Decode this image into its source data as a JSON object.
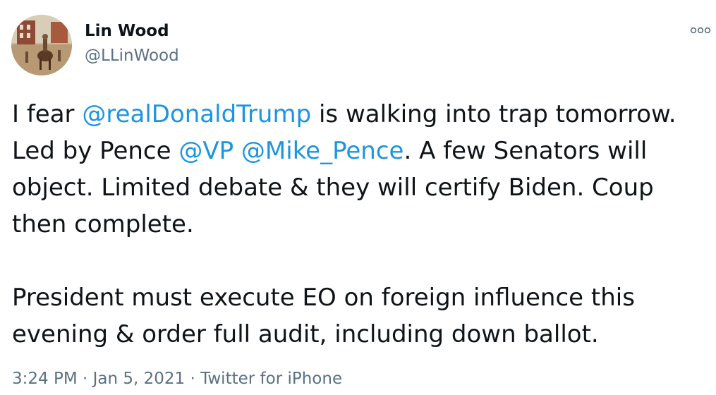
{
  "author": {
    "display_name": "Lin Wood",
    "handle": "@LLinWood"
  },
  "more_icon": "more-options-icon",
  "tweet": {
    "lines": [
      [
        {
          "text": "I fear ",
          "mention": false
        },
        {
          "text": "@realDonaldTrump",
          "mention": true
        },
        {
          "text": " is walking into trap tomorrow.",
          "mention": false
        }
      ],
      [
        {
          "text": "Led by Pence ",
          "mention": false
        },
        {
          "text": "@VP",
          "mention": true
        },
        {
          "text": " ",
          "mention": false
        },
        {
          "text": "@Mike_Pence",
          "mention": true
        },
        {
          "text": ". A few Senators will",
          "mention": false
        }
      ],
      [
        {
          "text": "object. Limited debate & they will certify Biden. Coup",
          "mention": false
        }
      ],
      [
        {
          "text": "then complete.",
          "mention": false
        }
      ],
      null,
      [
        {
          "text": "President must execute EO on foreign influence this",
          "mention": false
        }
      ],
      [
        {
          "text": "evening & order full audit, including down ballot.",
          "mention": false
        }
      ]
    ]
  },
  "meta": {
    "time": "3:24 PM",
    "sep1": " · ",
    "date": "Jan 5, 2021",
    "sep2": " · ",
    "source": "Twitter for iPhone"
  },
  "colors": {
    "mention": "#1b95e0",
    "secondary": "#5b7083",
    "text": "#0f1419"
  }
}
